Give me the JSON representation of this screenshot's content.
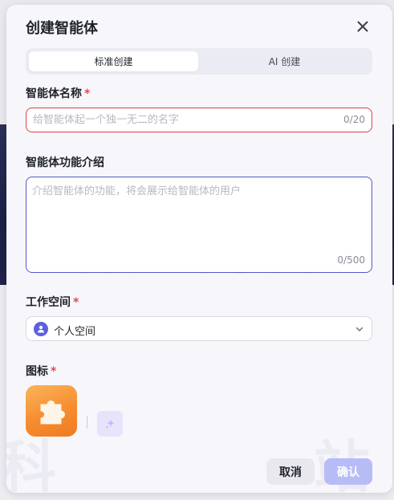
{
  "modal": {
    "title": "创建智能体",
    "close_icon": "close-icon"
  },
  "tabs": [
    {
      "label": "标准创建",
      "active": true
    },
    {
      "label": "AI 创建",
      "active": false
    }
  ],
  "name_field": {
    "label": "智能体名称",
    "required_mark": "*",
    "value": "",
    "placeholder": "给智能体起一个独一无二的名字",
    "counter": "0/20"
  },
  "description_field": {
    "label": "智能体功能介绍",
    "value": "",
    "placeholder": "介绍智能体的功能，将会展示给智能体的用户",
    "counter": "0/500"
  },
  "workspace_field": {
    "label": "工作空间",
    "required_mark": "*",
    "selected": "个人空间",
    "avatar_icon": "user-icon",
    "dropdown_icon": "chevron-down-icon"
  },
  "icon_field": {
    "label": "图标",
    "required_mark": "*",
    "current_icon": "puzzle-piece-icon",
    "generate_icon": "sparkle-icon"
  },
  "watermark": {
    "text_main": "站长百科",
    "text_left": "科",
    "text_right": "站"
  },
  "footer": {
    "cancel_label": "取消",
    "confirm_label": "确认"
  },
  "colors": {
    "accent": "#5458c7",
    "error": "#d9414a",
    "required": "#e5484d",
    "confirm_disabled": "#b8bcf6",
    "icon_gradient_start": "#fbb45d",
    "icon_gradient_end": "#f07a23"
  }
}
